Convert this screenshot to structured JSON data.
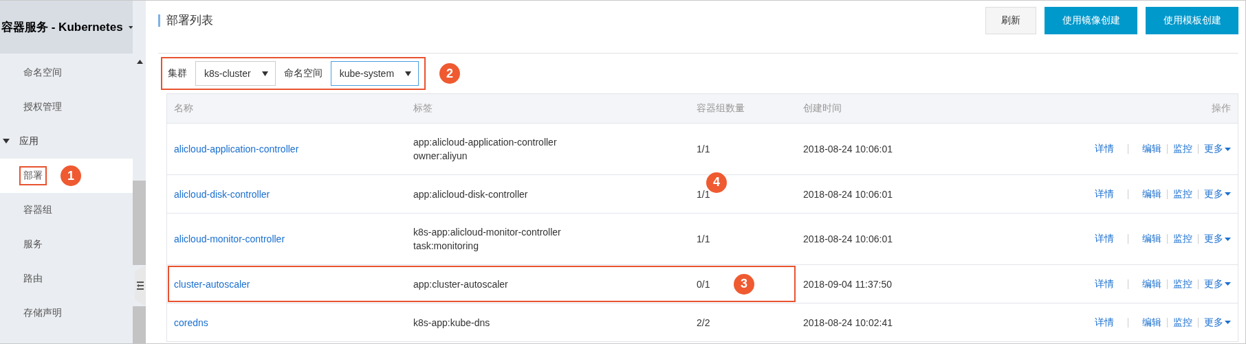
{
  "sidebar": {
    "title": "容器服务 - Kubernetes",
    "items": [
      {
        "label": "命名空间",
        "kind": "item",
        "selected": false,
        "highlighted": false
      },
      {
        "label": "授权管理",
        "kind": "item",
        "selected": false,
        "highlighted": false
      },
      {
        "label": "应用",
        "kind": "group",
        "expanded": true,
        "selected": false,
        "highlighted": false
      },
      {
        "label": "部署",
        "kind": "item",
        "selected": true,
        "highlighted": true,
        "badge": "1"
      },
      {
        "label": "容器组",
        "kind": "item",
        "selected": false,
        "highlighted": false
      },
      {
        "label": "服务",
        "kind": "item",
        "selected": false,
        "highlighted": false
      },
      {
        "label": "路由",
        "kind": "item",
        "selected": false,
        "highlighted": false
      },
      {
        "label": "存储声明",
        "kind": "item",
        "selected": false,
        "highlighted": false
      }
    ]
  },
  "page": {
    "title": "部署列表",
    "buttons": [
      {
        "label": "刷新",
        "kind": "default"
      },
      {
        "label": "使用镜像创建",
        "kind": "primary"
      },
      {
        "label": "使用模板创建",
        "kind": "primary"
      }
    ]
  },
  "filters": {
    "highlighted": true,
    "badge": "2",
    "fields": [
      {
        "label": "集群",
        "value": "k8s-cluster",
        "focused": false
      },
      {
        "label": "命名空间",
        "value": "kube-system",
        "focused": true
      }
    ]
  },
  "table": {
    "columns": [
      "名称",
      "标签",
      "容器组数量",
      "创建时间",
      "操作"
    ],
    "actions": [
      [
        "详情",
        "编辑",
        "监控",
        "更多"
      ],
      [
        "详情",
        "编辑",
        "监控",
        "更多"
      ],
      [
        "详情",
        "编辑",
        "监控",
        "更多"
      ],
      [
        "详情",
        "编辑",
        "监控",
        "更多"
      ],
      [
        "详情",
        "编辑",
        "监控",
        "更多"
      ]
    ],
    "rows": [
      {
        "name": "alicloud-application-controller",
        "labels": [
          "app:alicloud-application-controller",
          "owner:aliyun"
        ],
        "pods": "1/1",
        "created": "2018-08-24 10:06:01",
        "highlighted": false
      },
      {
        "name": "alicloud-disk-controller",
        "labels": [
          "app:alicloud-disk-controller"
        ],
        "pods": "1/1",
        "created": "2018-08-24 10:06:01",
        "highlighted": false,
        "badge": "4"
      },
      {
        "name": "alicloud-monitor-controller",
        "labels": [
          "k8s-app:alicloud-monitor-controller",
          "task:monitoring"
        ],
        "pods": "1/1",
        "created": "2018-08-24 10:06:01",
        "highlighted": false
      },
      {
        "name": "cluster-autoscaler",
        "labels": [
          "app:cluster-autoscaler"
        ],
        "pods": "0/1",
        "created": "2018-09-04 11:37:50",
        "highlighted": true,
        "badge": "3"
      },
      {
        "name": "coredns",
        "labels": [
          "k8s-app:kube-dns"
        ],
        "pods": "2/2",
        "created": "2018-08-24 10:02:41",
        "highlighted": false
      }
    ]
  }
}
